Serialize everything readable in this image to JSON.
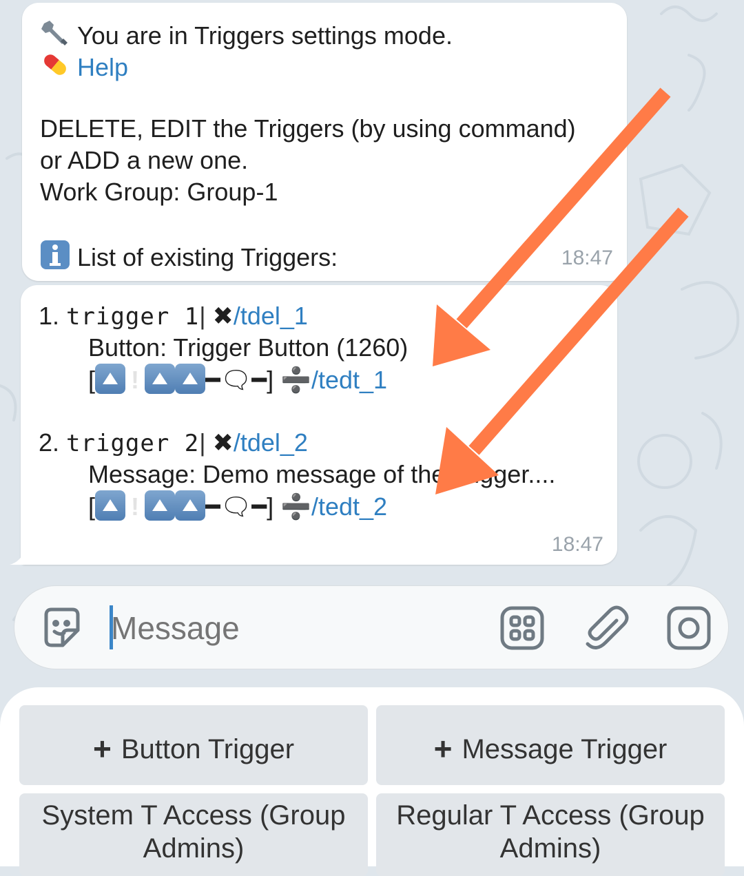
{
  "message1": {
    "line1": "You are in Triggers settings mode.",
    "help_link": "Help",
    "line3": "DELETE, EDIT the Triggers (by using command)",
    "line4": "or ADD a new one.",
    "line5": "Work Group: Group-1",
    "line6": "List of existing Triggers:",
    "time": "18:47",
    "icons": [
      "wrench-icon",
      "pill-icon",
      "info-icon"
    ]
  },
  "message2": {
    "triggers": [
      {
        "number": "1.",
        "name": "trigger 1",
        "separator": "|",
        "delete_mark": "✖",
        "delete_cmd": "/tdel_1",
        "detail": "Button: Trigger Button (1260)",
        "flags_open": "[",
        "flags_close": "]",
        "edit_mark": "➗",
        "edit_cmd": "/tedt_1"
      },
      {
        "number": "2.",
        "name": "trigger 2",
        "separator": "|",
        "delete_mark": "✖",
        "delete_cmd": "/tdel_2",
        "detail": "Message: Demo message of the Trigger....",
        "flags_open": "[",
        "flags_close": "]",
        "edit_mark": "➗",
        "edit_cmd": "/tedt_2"
      }
    ],
    "time": "18:47"
  },
  "composer": {
    "placeholder": "Message",
    "icons": [
      "sticker-icon",
      "bot-menu-icon",
      "attach-icon",
      "camera-icon"
    ]
  },
  "keyboard": {
    "buttons": [
      {
        "plus": "+",
        "label": "Button Trigger"
      },
      {
        "plus": "+",
        "label": "Message Trigger"
      },
      {
        "label": "System T Access (Group Admins)"
      },
      {
        "label": "Regular T Access (Group Admins)"
      }
    ]
  },
  "colors": {
    "link": "#2f7fc1",
    "arrow": "#ff7b47",
    "background": "#dfe6ec"
  }
}
